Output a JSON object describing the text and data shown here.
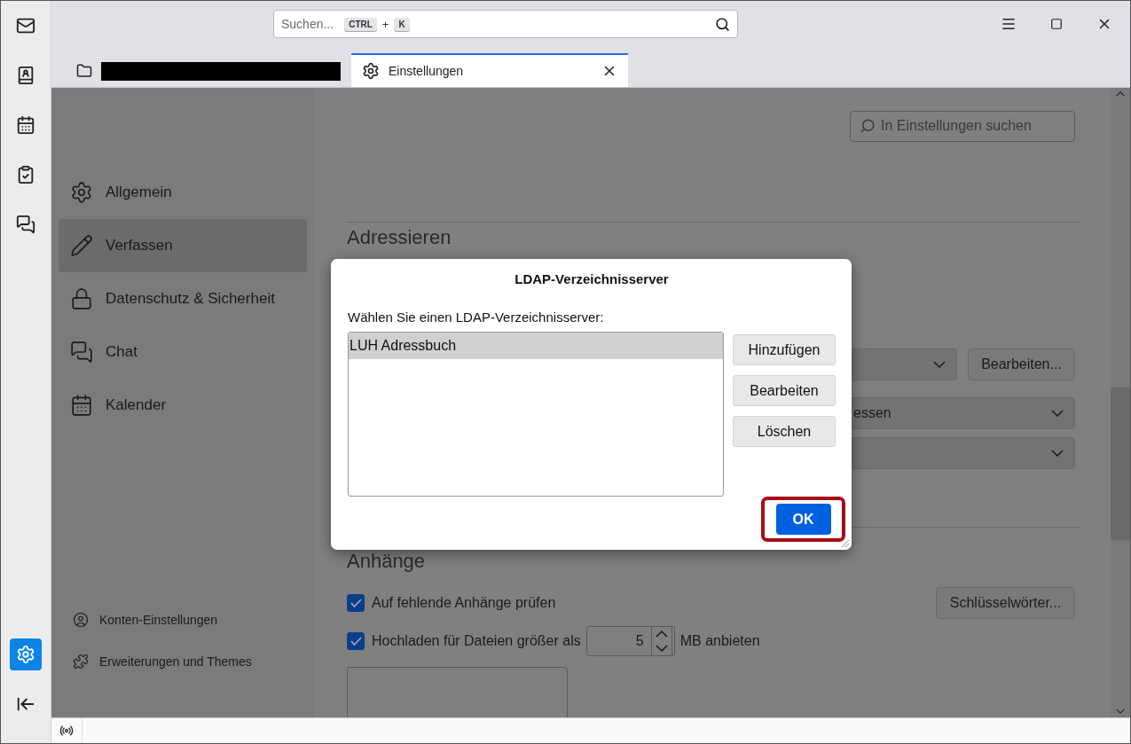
{
  "spaces_bar": {
    "items": [
      {
        "kind": "mail",
        "selected": false
      },
      {
        "kind": "address-book",
        "selected": false
      },
      {
        "kind": "calendar",
        "selected": false
      },
      {
        "kind": "tasks",
        "selected": false
      },
      {
        "kind": "chat",
        "selected": false
      }
    ],
    "bottom": [
      {
        "kind": "settings",
        "selected": true
      },
      {
        "kind": "collapse",
        "selected": false
      }
    ]
  },
  "search": {
    "placeholder": "Suchen...",
    "keys": [
      "CTRL",
      "+",
      "K"
    ]
  },
  "tabs": [
    {
      "kind": "redacted",
      "selected": false
    },
    {
      "kind": "settings",
      "label": "Einstellungen",
      "selected": true
    }
  ],
  "nav": {
    "items": [
      {
        "kind": "gear",
        "label": "Allgemein",
        "selected": false
      },
      {
        "kind": "pencil",
        "label": "Verfassen",
        "selected": true
      },
      {
        "kind": "lock",
        "label": "Datenschutz & Sicherheit",
        "selected": false
      },
      {
        "kind": "chat",
        "label": "Chat",
        "selected": false
      },
      {
        "kind": "calendar",
        "label": "Kalender",
        "selected": false
      }
    ],
    "footer": [
      {
        "kind": "account",
        "label": "Konten-Einstellungen"
      },
      {
        "kind": "puzzle",
        "label": "Erweiterungen und Themes"
      }
    ]
  },
  "settings_search": {
    "placeholder": "In Einstellungen suchen"
  },
  "addressing": {
    "heading": "Adressieren",
    "edit_button": "Bearbeiten...",
    "dropdown_text": "essen"
  },
  "attachments": {
    "heading": "Anhänge",
    "options": [
      {
        "label": "Auf fehlende Anhänge prüfen",
        "checked": true
      },
      {
        "label": "Hochladen für Dateien größer als",
        "checked": true,
        "value": "5",
        "suffix": "MB anbieten"
      }
    ],
    "keywords_button": "Schlüsselwörter..."
  },
  "dialog": {
    "title": "LDAP-Verzeichnisserver",
    "label": "Wählen Sie einen LDAP-Verzeichnisserver:",
    "servers": [
      {
        "label": "LUH Adressbuch",
        "selected": true
      }
    ],
    "buttons": [
      "Hinzufügen",
      "Bearbeiten",
      "Löschen"
    ],
    "ok": "OK",
    "ok_highlighted": true
  }
}
